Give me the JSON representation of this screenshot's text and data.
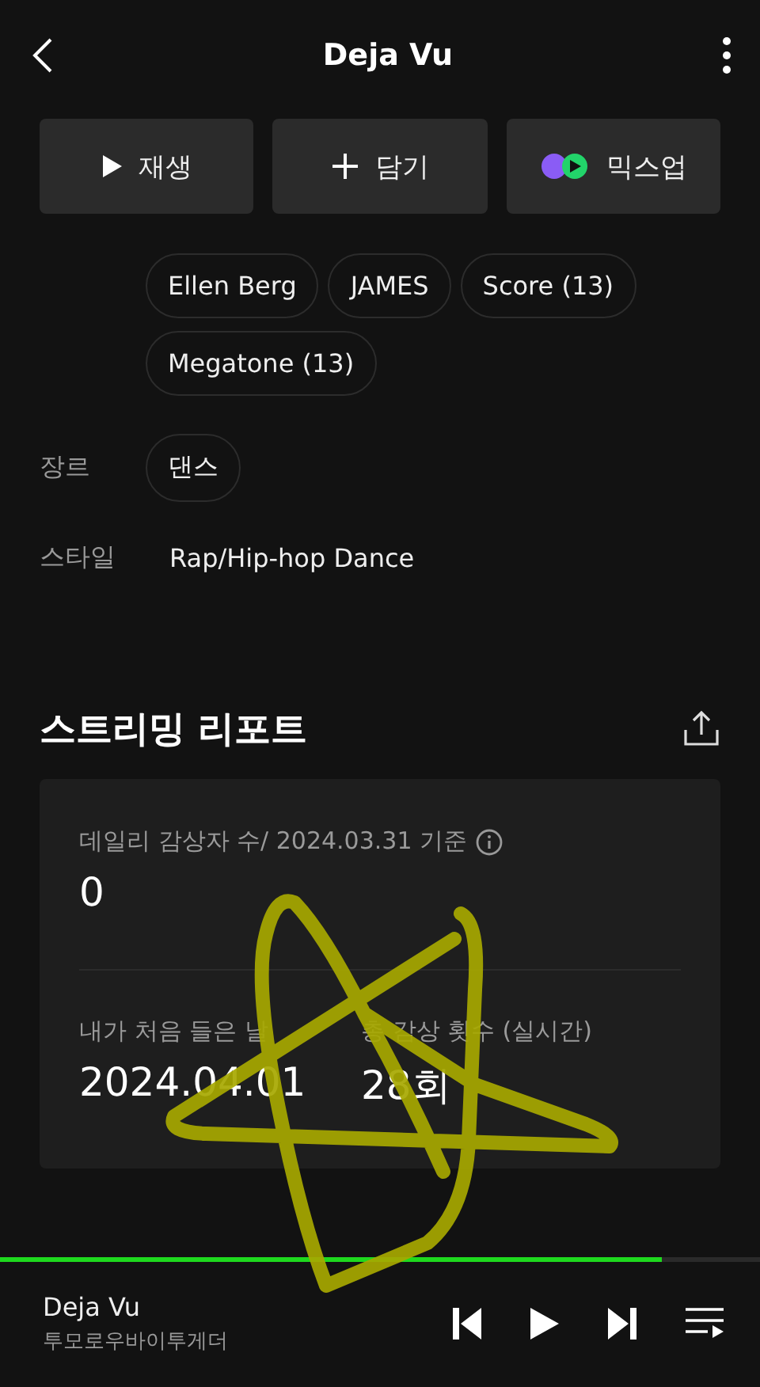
{
  "header": {
    "title": "Deja Vu"
  },
  "actions": [
    {
      "kind": "play",
      "label": "재생"
    },
    {
      "kind": "add",
      "label": "담기"
    },
    {
      "kind": "mixup",
      "label": "믹스업"
    }
  ],
  "credits": {
    "chips": [
      "Ellen Berg",
      "JAMES",
      "Score (13)",
      "Megatone (13)"
    ]
  },
  "genre": {
    "label": "장르",
    "chips": [
      "댄스"
    ]
  },
  "style": {
    "label": "스타일",
    "value": "Rap/Hip-hop Dance"
  },
  "report": {
    "title": "스트리밍 리포트",
    "daily": {
      "label": "데일리 감상자 수/ 2024.03.31 기준",
      "value": "0"
    },
    "stats": [
      {
        "label": "내가 처음 들은 날",
        "value": "2024.04.01"
      },
      {
        "label": "총 감상 횟수 (실시간)",
        "value": "28회"
      }
    ]
  },
  "player": {
    "title": "Deja Vu",
    "artist": "투모로우바이투게더",
    "level": 0.87
  }
}
